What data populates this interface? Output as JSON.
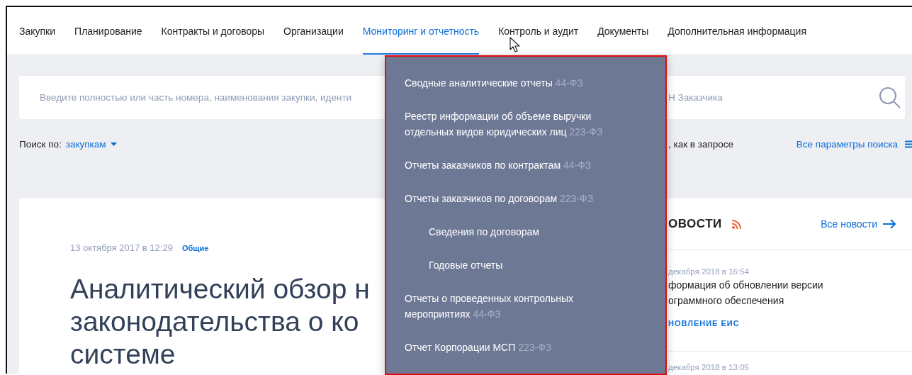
{
  "nav": [
    {
      "label": "Закупки",
      "selected": false
    },
    {
      "label": "Планирование",
      "selected": false
    },
    {
      "label": "Контракты и договоры",
      "selected": false
    },
    {
      "label": "Организации",
      "selected": false
    },
    {
      "label": "Мониторинг и отчетность",
      "selected": true
    },
    {
      "label": "Контроль и аудит",
      "selected": false
    },
    {
      "label": "Документы",
      "selected": false
    },
    {
      "label": "Дополнительная информация",
      "selected": false
    }
  ],
  "search": {
    "placeholder": "Введите полностью или часть номера, наименования закупки, иденти",
    "placeholder_end": "Н Заказчика"
  },
  "search_by": {
    "label": "Поиск по:",
    "value": "закупкам"
  },
  "search_options": {
    "match_text": ", как в запросе",
    "all_params_link": "Все параметры поиска"
  },
  "article": {
    "date": "13 октября 2017 в 12:29",
    "tag": "Общие",
    "title_lines": [
      "Аналитический обзор н",
      "законодательства о ко",
      "системе"
    ]
  },
  "news": {
    "heading": "ОВОСТИ",
    "all_link": "Все новости",
    "items": [
      {
        "date": "декабря 2018 в 16:54",
        "title_lines": [
          "формация об обновлении версии",
          "ограммного обеспечения"
        ],
        "tag": "НОВЛЕНИЕ ЕИС"
      },
      {
        "date": "декабря 2018 в 13:05"
      }
    ]
  },
  "dropdown": {
    "items": [
      {
        "label": "Сводные аналитические отчеты",
        "law": "44-ФЗ"
      },
      {
        "label": "Реестр информации об объеме выручки отдельных видов юридических лиц",
        "law": "223-ФЗ"
      },
      {
        "label": "Отчеты заказчиков по контрактам",
        "law": "44-ФЗ"
      },
      {
        "label": "Отчеты заказчиков по договорам",
        "law": "223-ФЗ",
        "children": [
          {
            "label": "Сведения по договорам"
          },
          {
            "label": "Годовые отчеты"
          }
        ]
      },
      {
        "label": "Отчеты о проведенных контрольных мероприятиях",
        "law": "44-ФЗ"
      },
      {
        "label": "Отчет Корпорации МСП",
        "law": "223-ФЗ"
      }
    ]
  }
}
